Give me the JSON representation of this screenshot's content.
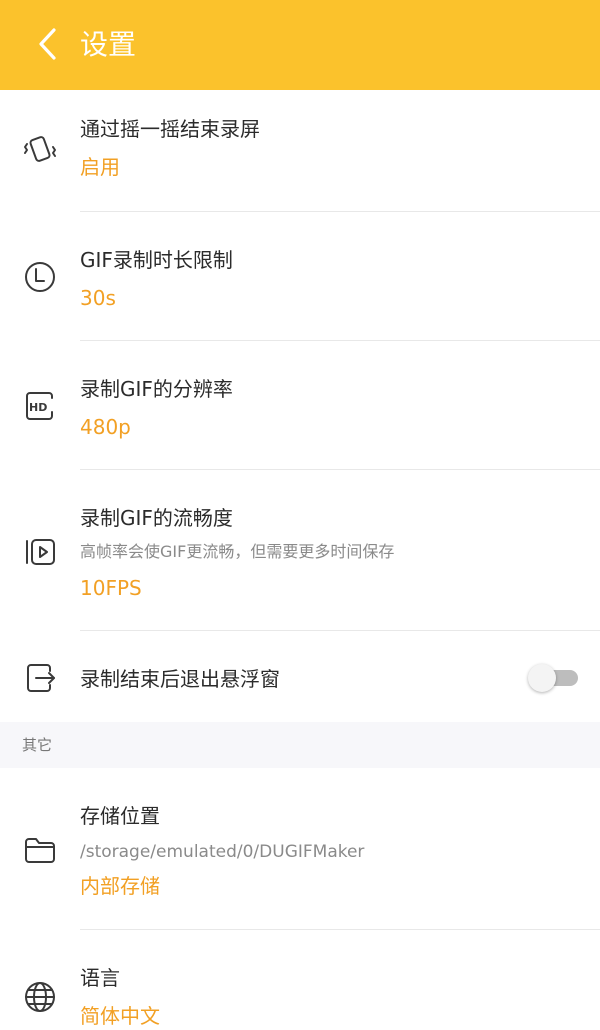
{
  "header": {
    "title": "设置",
    "bg_color": "#FBC22C"
  },
  "settings": [
    {
      "label": "通过摇一摇结束录屏",
      "value": "启用",
      "icon": "shake-phone-icon"
    },
    {
      "label": "GIF录制时长限制",
      "value": "30s",
      "icon": "clock-icon"
    },
    {
      "label": "录制GIF的分辨率",
      "value": "480p",
      "icon": "hd-icon"
    },
    {
      "label": "录制GIF的流畅度",
      "description": "高帧率会使GIF更流畅，但需要更多时间保存",
      "value": "10FPS",
      "icon": "video-frames-icon"
    },
    {
      "label": "录制结束后退出悬浮窗",
      "icon": "exit-icon",
      "toggle_on": false
    }
  ],
  "section_other": {
    "label": "其它",
    "items": [
      {
        "label": "存储位置",
        "description": "/storage/emulated/0/DUGIFMaker",
        "value": "内部存储",
        "icon": "folder-icon"
      },
      {
        "label": "语言",
        "value": "简体中文",
        "icon": "globe-icon"
      }
    ]
  },
  "colors": {
    "accent": "#F2A024",
    "text": "#2b2b2b",
    "subtext": "#8a8a8a",
    "section_bg": "#F7F7FA"
  }
}
